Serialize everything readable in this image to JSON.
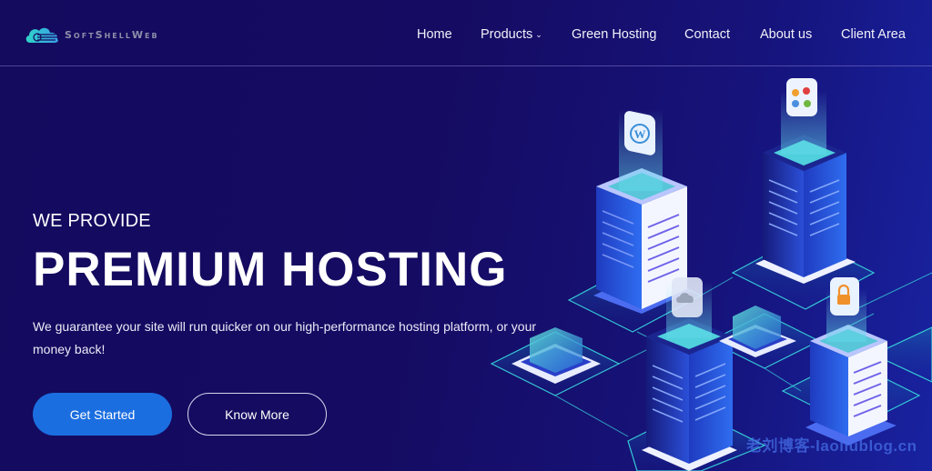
{
  "brand": {
    "name": "SoftShellWeb",
    "logo_icon": "cloud-circuit-icon",
    "logo_colors": [
      "#2fd3c8",
      "#3aa0e8"
    ]
  },
  "nav": {
    "items": [
      {
        "label": "Home"
      },
      {
        "label": "Products",
        "has_dropdown": true,
        "dropdown_icon": "chevron-down-icon"
      },
      {
        "label": "Green Hosting"
      },
      {
        "label": "Contact"
      },
      {
        "label": "About us"
      },
      {
        "label": "Client Area"
      }
    ]
  },
  "hero": {
    "eyebrow": "WE PROVIDE",
    "headline": "PREMIUM HOSTING",
    "description": "We guarantee your site will run quicker on our high-performance hosting platform, or your money back!",
    "primary_button": "Get Started",
    "secondary_button": "Know More"
  },
  "illustration": {
    "badges": [
      "wordpress-icon",
      "joomla-icon",
      "cloud-icon",
      "lock-icon"
    ]
  },
  "watermark": "老刘博客-laoliublog.cn",
  "colors": {
    "background": "#140a5e",
    "primary_button": "#1b6ee0",
    "accent_teal": "#2fd3c8"
  }
}
